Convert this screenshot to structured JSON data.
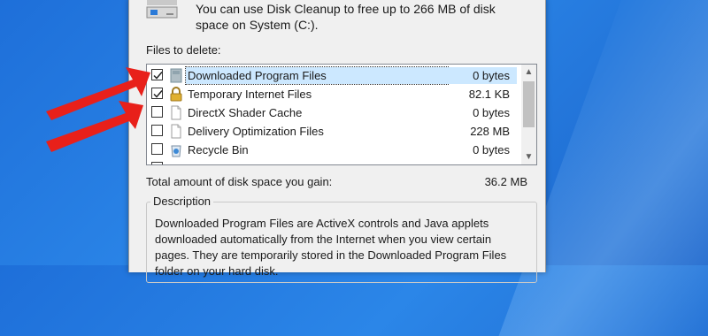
{
  "summary": "You can use Disk Cleanup to free up to 266 MB of disk space on System (C:).",
  "files_label": "Files to delete:",
  "files": [
    {
      "name": "Downloaded Program Files",
      "size": "0 bytes",
      "checked": true,
      "selected": true,
      "icon": "folder-icon"
    },
    {
      "name": "Temporary Internet Files",
      "size": "82.1 KB",
      "checked": true,
      "selected": false,
      "icon": "lock-icon"
    },
    {
      "name": "DirectX Shader Cache",
      "size": "0 bytes",
      "checked": false,
      "selected": false,
      "icon": "page-icon"
    },
    {
      "name": "Delivery Optimization Files",
      "size": "228 MB",
      "checked": false,
      "selected": false,
      "icon": "page-icon"
    },
    {
      "name": "Recycle Bin",
      "size": "0 bytes",
      "checked": false,
      "selected": false,
      "icon": "recycle-bin-icon"
    }
  ],
  "total_label": "Total amount of disk space you gain:",
  "total_value": "36.2 MB",
  "description_title": "Description",
  "description_text": "Downloaded Program Files are ActiveX controls and Java applets downloaded automatically from the Internet when you view certain pages. They are temporarily stored in the Downloaded Program Files folder on your hard disk.",
  "colors": {
    "selection": "#cce8ff",
    "arrow": "#e8201a",
    "desktop": "#1e6fd9"
  }
}
